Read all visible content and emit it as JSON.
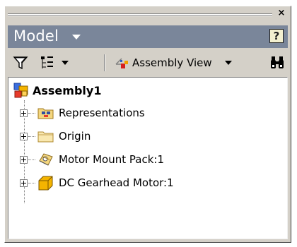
{
  "panel": {
    "title": "Model",
    "close_glyph": "×",
    "help_glyph": "?"
  },
  "toolbar": {
    "view_label": "Assembly View",
    "icons": [
      "filter-icon",
      "structure-icon",
      "assembly-view-icon",
      "binoculars-icon"
    ]
  },
  "tree": {
    "root": {
      "label": "Assembly1",
      "icon": "assembly-icon"
    },
    "items": [
      {
        "label": "Representations",
        "icon": "representations-icon"
      },
      {
        "label": "Origin",
        "icon": "folder-icon"
      },
      {
        "label": "Motor Mount Pack:1",
        "icon": "subassembly-icon"
      },
      {
        "label": "DC Gearhead Motor:1",
        "icon": "part-icon"
      }
    ]
  },
  "colors": {
    "header_bg": "#7a869a",
    "panel_bg": "#d4d0c8",
    "folder": "#f5d77e",
    "part": "#f4b400"
  }
}
